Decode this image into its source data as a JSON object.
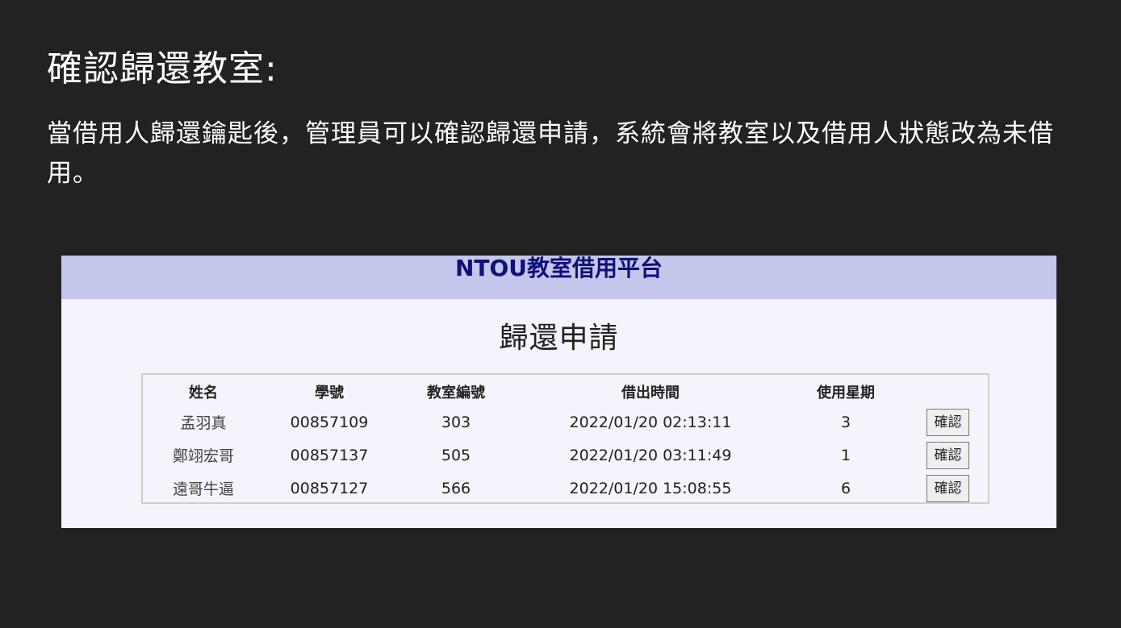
{
  "slide": {
    "title": "確認歸還教室:",
    "description": "當借用人歸還鑰匙後，管理員可以確認歸還申請，系統會將教室以及借用人狀態改為未借用。"
  },
  "app": {
    "brand": "NTOU教室借用平台",
    "heading": "歸還申請",
    "colors": {
      "header_bg": "#c5c6eb",
      "brand_text": "#101078",
      "page_bg": "#f4f4fd"
    },
    "table": {
      "headers": [
        "姓名",
        "學號",
        "教室編號",
        "借出時間",
        "使用星期",
        ""
      ],
      "rows": [
        {
          "name": "孟羽真",
          "student_id": "00857109",
          "room": "303",
          "borrow_time": "2022/01/20 02:13:11",
          "weekday": "3",
          "action": "確認"
        },
        {
          "name": "鄭翊宏哥",
          "student_id": "00857137",
          "room": "505",
          "borrow_time": "2022/01/20 03:11:49",
          "weekday": "1",
          "action": "確認"
        },
        {
          "name": "遠哥牛逼",
          "student_id": "00857127",
          "room": "566",
          "borrow_time": "2022/01/20 15:08:55",
          "weekday": "6",
          "action": "確認"
        }
      ]
    }
  }
}
